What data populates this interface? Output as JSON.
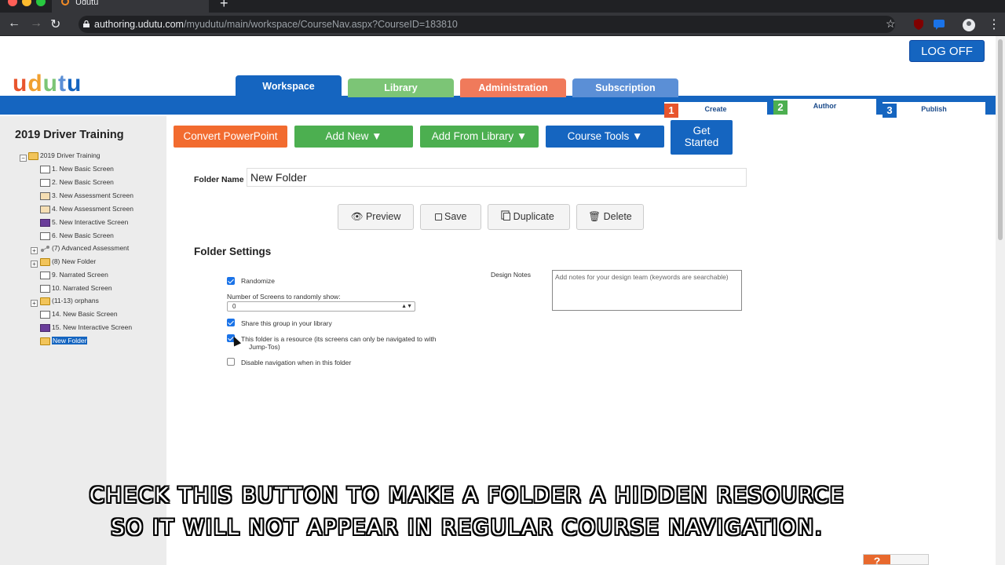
{
  "browser": {
    "tab_title": "Udutu",
    "url_host": "authoring.udutu.com",
    "url_path": "/myudutu/main/workspace/CourseNav.aspx?CourseID=183810"
  },
  "header": {
    "logo_text": "udutu",
    "logoff_label": "LOG OFF",
    "nav_tabs": [
      {
        "label": "Workspace",
        "color": "#1565c0"
      },
      {
        "label": "Library",
        "color": "#7cc576"
      },
      {
        "label": "Administration",
        "color": "#f07a5b"
      },
      {
        "label": "Subscription",
        "color": "#5b8fd6"
      }
    ],
    "steps": [
      {
        "num": "1",
        "label": "Create",
        "color": "#e8552d"
      },
      {
        "num": "2",
        "label": "Author",
        "color": "#4caf50"
      },
      {
        "num": "3",
        "label": "Publish",
        "color": "#1565c0"
      }
    ]
  },
  "sidebar": {
    "course_title": "2019 Driver Training",
    "root": "2019 Driver Training",
    "items": [
      {
        "label": "1. New Basic Screen",
        "type": "basic"
      },
      {
        "label": "2. New Basic Screen",
        "type": "basic"
      },
      {
        "label": "3. New Assessment Screen",
        "type": "assess"
      },
      {
        "label": "4. New Assessment Screen",
        "type": "assess"
      },
      {
        "label": "5. New Interactive Screen",
        "type": "inter"
      },
      {
        "label": "6. New Basic Screen",
        "type": "basic"
      },
      {
        "label": "(7) Advanced Assessment",
        "type": "adv"
      },
      {
        "label": "(8) New Folder",
        "type": "folder"
      },
      {
        "label": "9. Narrated Screen",
        "type": "basic"
      },
      {
        "label": "10. Narrated Screen",
        "type": "basic"
      },
      {
        "label": "(11-13) orphans",
        "type": "folder"
      },
      {
        "label": "14. New Basic Screen",
        "type": "basic"
      },
      {
        "label": "15. New Interactive Screen",
        "type": "inter"
      },
      {
        "label": "New Folder",
        "type": "folder"
      }
    ]
  },
  "toolbar": {
    "convert": "Convert PowerPoint",
    "add_new": "Add New ▼",
    "add_from_library": "Add From Library ▼",
    "course_tools": "Course Tools ▼",
    "get_started_1": "Get",
    "get_started_2": "Started",
    "colors": {
      "convert": "#f26b2f",
      "green": "#4caf50",
      "blue": "#1565c0"
    }
  },
  "folder": {
    "name_label": "Folder Name",
    "name_value": "New Folder",
    "actions": {
      "preview": "Preview",
      "save": "Save",
      "duplicate": "Duplicate",
      "delete": "Delete"
    }
  },
  "settings": {
    "title": "Folder Settings",
    "randomize": {
      "label": "Randomize",
      "checked": true
    },
    "num_screens_label": "Number of Screens to randomly show:",
    "num_screens_value": "0",
    "share": {
      "label": "Share this group in your library",
      "checked": true
    },
    "resource": {
      "label_line1": "This folder is a resource (its screens can only be navigated to with",
      "label_line2": "Jump-Tos)",
      "checked": true
    },
    "disable_nav": {
      "label": "Disable navigation when in this folder",
      "checked": false
    },
    "design_notes_label": "Design Notes",
    "design_notes_placeholder": "Add notes for your design team (keywords are searchable)"
  },
  "caption": {
    "line1": "CHECK THIS BUTTON TO MAKE A FOLDER A HIDDEN RESOURCE",
    "line2": "SO IT WILL NOT APPEAR IN REGULAR COURSE NAVIGATION."
  },
  "help": {
    "label": "?"
  }
}
